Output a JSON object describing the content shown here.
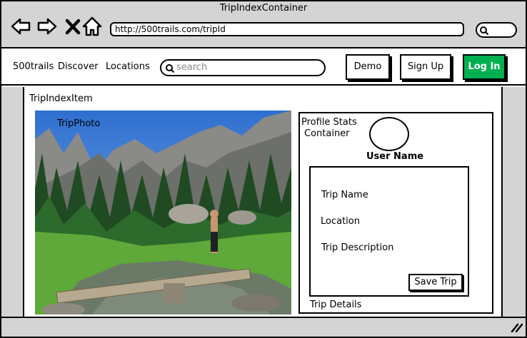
{
  "window": {
    "title": "TripIndexContainer",
    "url": "http://500trails.com/tripId"
  },
  "navbar": {
    "brand": "500trails",
    "links": [
      "Discover",
      "Locations"
    ],
    "search_placeholder": "search",
    "demo_label": "Demo",
    "signup_label": "Sign Up",
    "login_label": "Log In"
  },
  "main": {
    "container_label": "TripIndexItem",
    "photo_label": "TripPhoto",
    "profile": {
      "container_label_line1": "Profile Stats",
      "container_label_line2": "Container",
      "user_name": "User Name"
    },
    "trip": {
      "name": "Trip Name",
      "location": "Location",
      "description": "Trip Description",
      "save_label": "Save Trip",
      "details_label": "Trip Details"
    }
  },
  "colors": {
    "chrome_gray": "#d4d4d4",
    "login_green": "#00b050"
  }
}
